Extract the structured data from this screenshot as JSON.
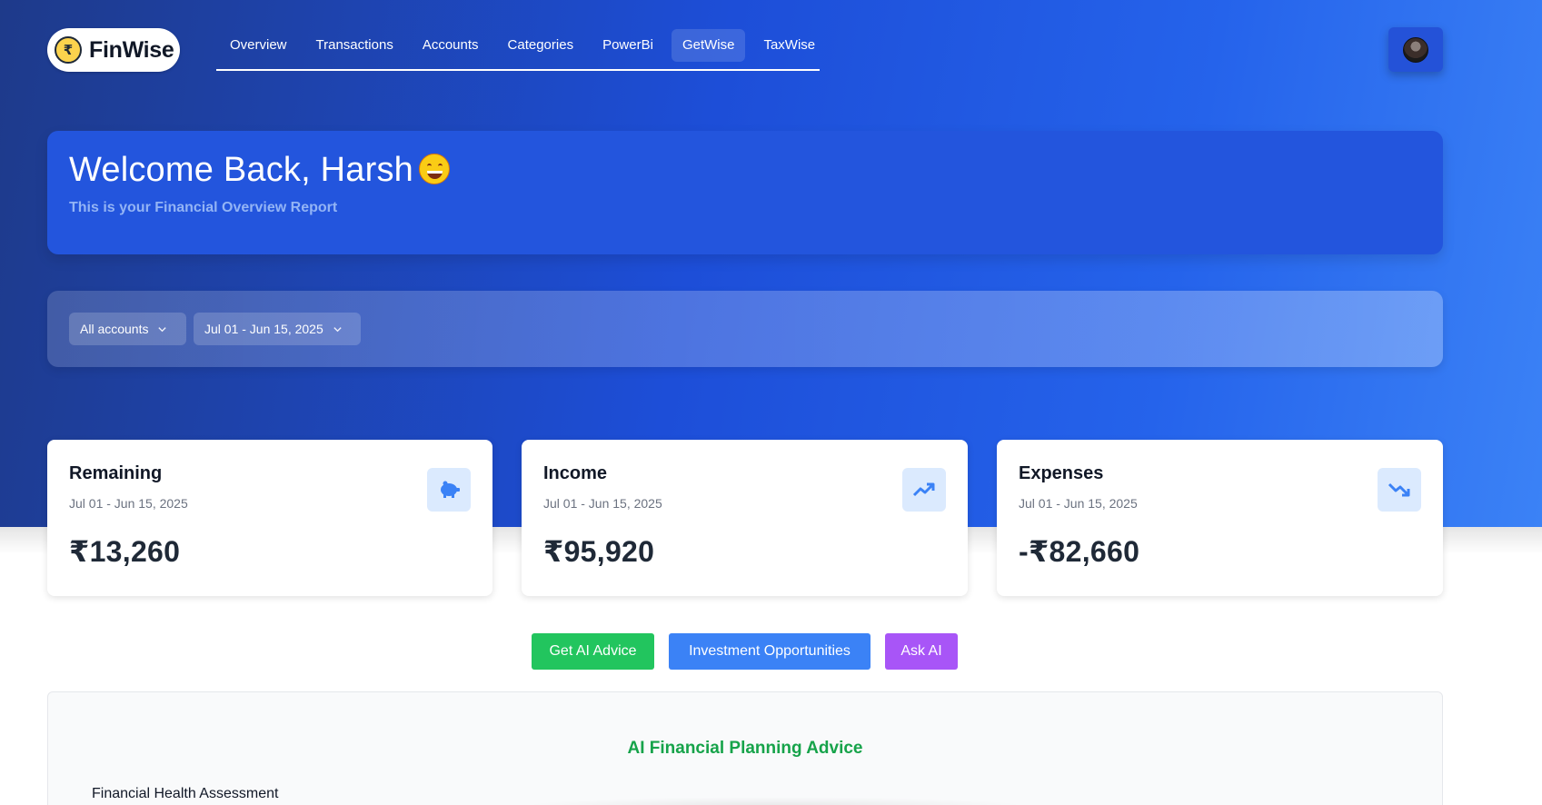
{
  "brand": {
    "name": "FinWise",
    "logo_glyph": "₹"
  },
  "nav": {
    "items": [
      {
        "label": "Overview"
      },
      {
        "label": "Transactions"
      },
      {
        "label": "Accounts"
      },
      {
        "label": "Categories"
      },
      {
        "label": "PowerBi"
      },
      {
        "label": "GetWise"
      },
      {
        "label": "TaxWise"
      }
    ],
    "active": "GetWise"
  },
  "welcome": {
    "title": "Welcome Back, Harsh",
    "subtitle": "This is your Financial Overview Report"
  },
  "filters": {
    "account": "All accounts",
    "date_range": "Jul 01 - Jun 15, 2025"
  },
  "cards": [
    {
      "title": "Remaining",
      "period": "Jul 01 - Jun 15, 2025",
      "value": "₹13,260",
      "icon": "piggy-bank-icon"
    },
    {
      "title": "Income",
      "period": "Jul 01 - Jun 15, 2025",
      "value": "₹95,920",
      "icon": "trending-up-icon"
    },
    {
      "title": "Expenses",
      "period": "Jul 01 - Jun 15, 2025",
      "value": "-₹82,660",
      "icon": "trending-down-icon"
    }
  ],
  "actions": {
    "ai_advice": "Get AI Advice",
    "investment": "Investment Opportunities",
    "ask_ai": "Ask AI"
  },
  "advice": {
    "title": "AI Financial Planning Advice",
    "section": "Financial Health Assessment"
  },
  "colors": {
    "green": "#22c55e",
    "blue": "#3b82f6",
    "purple": "#a855f7",
    "advice_title": "#16a34a"
  }
}
